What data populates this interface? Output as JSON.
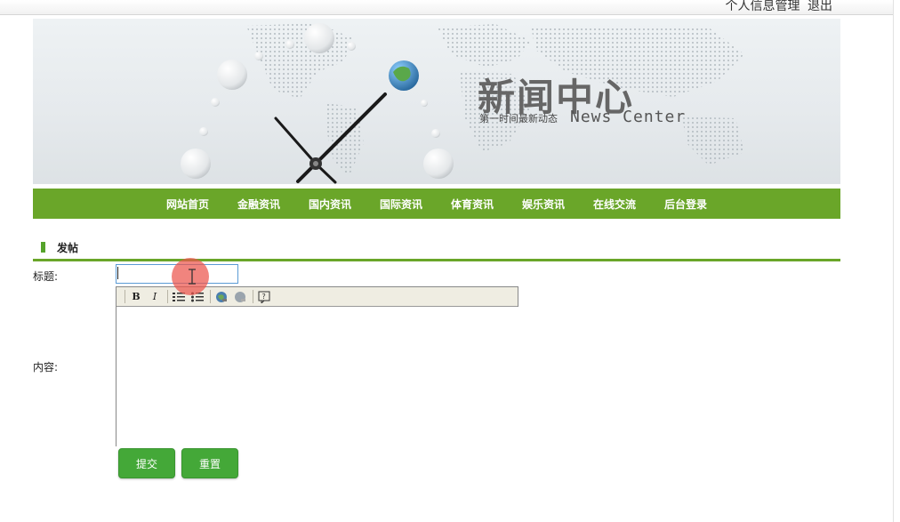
{
  "top_links": {
    "profile": "个人信息管理",
    "logout": "退出"
  },
  "banner": {
    "title": "新闻中心",
    "subtitle": "第一时间最新动态",
    "title_en": "News Center"
  },
  "nav": {
    "items": [
      {
        "label": "网站首页"
      },
      {
        "label": "金融资讯"
      },
      {
        "label": "国内资讯"
      },
      {
        "label": "国际资讯"
      },
      {
        "label": "体育资讯"
      },
      {
        "label": "娱乐资讯"
      },
      {
        "label": "在线交流"
      },
      {
        "label": "后台登录"
      }
    ]
  },
  "form": {
    "section_title": "发帖",
    "title_label": "标题:",
    "title_value": "",
    "content_label": "内容:",
    "content_value": "",
    "toolbar": {
      "bold": "B",
      "italic": "I",
      "icons": [
        "bold-icon",
        "italic-icon",
        "numbered-list-icon",
        "bulleted-list-icon",
        "link-icon",
        "unlink-icon",
        "help-icon"
      ]
    },
    "submit_label": "提交",
    "reset_label": "重置"
  },
  "colors": {
    "nav_bg": "#6aa629",
    "button_bg": "#44a838",
    "accent": "#55a32b"
  }
}
